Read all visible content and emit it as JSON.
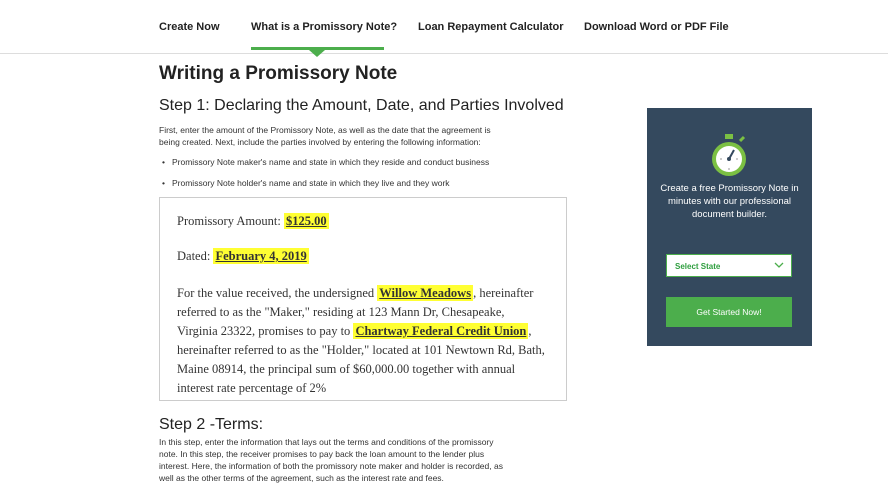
{
  "nav": {
    "items": [
      {
        "label": "Create  Now"
      },
      {
        "label": "What is a Promissory Note?"
      },
      {
        "label": "Loan Repayment Calculator"
      },
      {
        "label": "Download  Word or PDF File"
      }
    ],
    "active_index": 1,
    "accent": "#4cae4c"
  },
  "page_title": "Writing a Promissory Note",
  "step1": {
    "heading": "Step 1: Declaring the Amount, Date, and Parties Involved",
    "intro_line1": "First, enter the amount of the Promissory Note, as well as the date that the agreement is",
    "intro_line2": "being created. Next, include the parties involved by entering the following information:",
    "bullets": [
      "Promissory Note maker's name and state in which they reside and conduct business",
      "Promissory Note holder's name and state in which they live and they work"
    ]
  },
  "doc": {
    "amount_label": "Promissory Amount:",
    "amount_value": "$125.00",
    "dated_label": "Dated:",
    "dated_value": "February 4, 2019",
    "p1a": "For the value received, the undersigned",
    "maker_name": "Willow Meadows",
    "p1b": ", hereinafter",
    "p2": "referred to as the \"Maker,\" residing at 123 Mann Dr, Chesapeake,",
    "p3a": "Virginia 23322, promises to pay to",
    "holder_name": "Chartway Federal Credit Union",
    "p3b": ",",
    "p4": "hereinafter referred to as the \"Holder,\" located at 101 Newtown Rd, Bath,",
    "p5": "Maine 08914, the principal sum of $60,000.00 together with annual",
    "p6": "interest rate percentage of 2%"
  },
  "step2": {
    "heading": "Step 2 -Terms:",
    "lines": [
      "In this step, enter the information that lays out the terms and conditions of the promissory",
      "note. In this step, the receiver promises to pay back the loan amount to the lender plus",
      "interest. Here, the information of both the promissory note maker and holder is recorded, as",
      "well as the other terms of the agreement, such as the interest rate and fees."
    ]
  },
  "sidebar": {
    "text": "Create a free Promissory Note in minutes with our professional document builder.",
    "select_value": "Select State",
    "cta_label": "Get Started Now!",
    "bg_color": "#34495e",
    "button_color": "#4cae4c",
    "icon": "stopwatch-icon"
  }
}
